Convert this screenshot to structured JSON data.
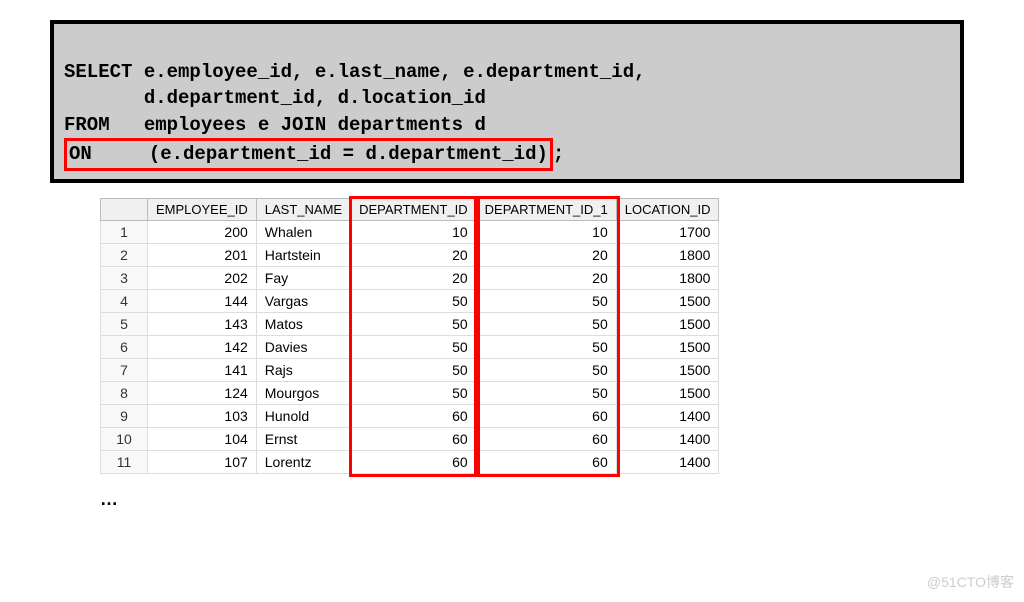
{
  "sql": {
    "line1": "SELECT e.employee_id, e.last_name, e.department_id,",
    "line2": "       d.department_id, d.location_id",
    "line3": "FROM   employees e JOIN departments d",
    "line4_on": "ON     (e.department_id = d.department_id)",
    "line4_semicolon": ";"
  },
  "table": {
    "headers": {
      "rownum": "",
      "employee_id": "EMPLOYEE_ID",
      "last_name": "LAST_NAME",
      "department_id": "DEPARTMENT_ID",
      "department_id_1": "DEPARTMENT_ID_1",
      "location_id": "LOCATION_ID"
    },
    "rows": [
      {
        "n": "1",
        "emp": "200",
        "name": "Whalen",
        "dep1": "10",
        "dep2": "10",
        "loc": "1700"
      },
      {
        "n": "2",
        "emp": "201",
        "name": "Hartstein",
        "dep1": "20",
        "dep2": "20",
        "loc": "1800"
      },
      {
        "n": "3",
        "emp": "202",
        "name": "Fay",
        "dep1": "20",
        "dep2": "20",
        "loc": "1800"
      },
      {
        "n": "4",
        "emp": "144",
        "name": "Vargas",
        "dep1": "50",
        "dep2": "50",
        "loc": "1500"
      },
      {
        "n": "5",
        "emp": "143",
        "name": "Matos",
        "dep1": "50",
        "dep2": "50",
        "loc": "1500"
      },
      {
        "n": "6",
        "emp": "142",
        "name": "Davies",
        "dep1": "50",
        "dep2": "50",
        "loc": "1500"
      },
      {
        "n": "7",
        "emp": "141",
        "name": "Rajs",
        "dep1": "50",
        "dep2": "50",
        "loc": "1500"
      },
      {
        "n": "8",
        "emp": "124",
        "name": "Mourgos",
        "dep1": "50",
        "dep2": "50",
        "loc": "1500"
      },
      {
        "n": "9",
        "emp": "103",
        "name": "Hunold",
        "dep1": "60",
        "dep2": "60",
        "loc": "1400"
      },
      {
        "n": "10",
        "emp": "104",
        "name": "Ernst",
        "dep1": "60",
        "dep2": "60",
        "loc": "1400"
      },
      {
        "n": "11",
        "emp": "107",
        "name": "Lorentz",
        "dep1": "60",
        "dep2": "60",
        "loc": "1400"
      }
    ]
  },
  "ellipsis": "…",
  "watermark": "@51CTO博客"
}
